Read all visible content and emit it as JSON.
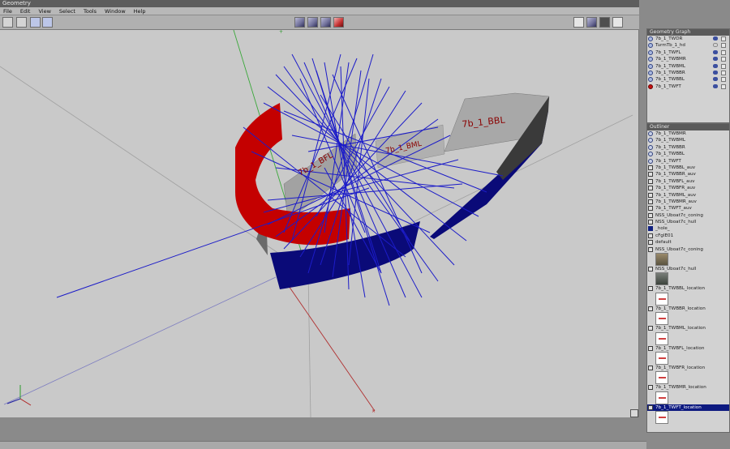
{
  "window": {
    "title": "Geometry"
  },
  "menu": [
    "File",
    "Edit",
    "View",
    "Select",
    "Tools",
    "Window",
    "Help"
  ],
  "toolbar": {
    "left_icons": [
      "open-folder-icon",
      "save-icon",
      "undo-arrow-icon",
      "redo-arrow-icon"
    ],
    "center_icons": [
      "cube-front-icon",
      "cube-side-icon",
      "cube-top-icon",
      "cube-red-icon"
    ],
    "right_icons": [
      "wireframe-window-icon",
      "shaded-cube-icon",
      "dark-view-icon",
      "window-icon"
    ]
  },
  "viewport": {
    "labels": [
      "7b_1_BBL",
      "7b_1_BML",
      "7b_1_BFL"
    ],
    "colors": {
      "red": "#c40000",
      "navy": "#0a0a78",
      "lines": "#1c1cc8",
      "panel_gray": "#a6a6a6",
      "background": "#c9c9c9"
    }
  },
  "geometry_graph": {
    "title": "Geometry Graph",
    "items": [
      {
        "label": "7b_1_TWDR",
        "icon": "mesh-icon",
        "visible": true
      },
      {
        "label": "TurmTb_1_hd",
        "icon": "mesh-icon",
        "visible": false
      },
      {
        "label": "7b_1_TWFL",
        "icon": "mesh-icon",
        "visible": true
      },
      {
        "label": "7b_1_TWBMR",
        "icon": "mesh-icon",
        "visible": true
      },
      {
        "label": "7b_1_TWBML",
        "icon": "mesh-icon",
        "visible": true
      },
      {
        "label": "7b_1_TWBBR",
        "icon": "mesh-icon",
        "visible": true
      },
      {
        "label": "7b_1_TWBBL",
        "icon": "mesh-icon",
        "visible": true
      },
      {
        "label": "7b_1_TWFT",
        "icon": "red-mesh-icon",
        "visible": true
      }
    ]
  },
  "outliner": {
    "title": "Outliner",
    "rows": [
      {
        "label": "7b_1_TWBMR",
        "icon": "mesh"
      },
      {
        "label": "7b_1_TWBML",
        "icon": "mesh"
      },
      {
        "label": "7b_1_TWBBR",
        "icon": "mesh"
      },
      {
        "label": "7b_1_TWBBL",
        "icon": "mesh"
      },
      {
        "label": "7b_1_TWFT",
        "icon": "mesh"
      },
      {
        "label": "7b_1_TWBBL_auv",
        "icon": "doc"
      },
      {
        "label": "7b_1_TWBBR_auv",
        "icon": "doc"
      },
      {
        "label": "7b_1_TWBFL_auv",
        "icon": "doc"
      },
      {
        "label": "7b_1_TWBFR_auv",
        "icon": "doc"
      },
      {
        "label": "7b_1_TWBML_auv",
        "icon": "doc"
      },
      {
        "label": "7b_1_TWBMR_auv",
        "icon": "doc"
      },
      {
        "label": "7b_1_TWFT_auv",
        "icon": "doc"
      },
      {
        "label": "NSS_Uboat7c_coning",
        "icon": "doc"
      },
      {
        "label": "NSS_Uboat7c_hull",
        "icon": "doc"
      },
      {
        "label": "_hole_",
        "icon": "blue"
      },
      {
        "label": "cFgIE01",
        "icon": "doc"
      },
      {
        "label": "default",
        "icon": "doc"
      },
      {
        "label": "NSS_Uboat7c_coning",
        "icon": "doc",
        "thumb": "hull"
      },
      {
        "label": "NSS_Uboat7c_hull",
        "icon": "doc",
        "thumb": "hull2"
      },
      {
        "label": "7b_1_TWBBL_location",
        "icon": "doc",
        "thumb": "white"
      },
      {
        "label": "7b_1_TWBBR_location",
        "icon": "doc",
        "thumb": "white"
      },
      {
        "label": "7b_1_TWBML_location",
        "icon": "doc",
        "thumb": "white"
      },
      {
        "label": "7b_1_TWBFL_location",
        "icon": "doc",
        "thumb": "white"
      },
      {
        "label": "7b_1_TWBFR_location",
        "icon": "doc",
        "thumb": "white"
      },
      {
        "label": "7b_1_TWBMR_location",
        "icon": "doc",
        "thumb": "white"
      },
      {
        "label": "7b_1_TWFT_location",
        "icon": "doc",
        "thumb": "white",
        "selected": true
      }
    ]
  }
}
